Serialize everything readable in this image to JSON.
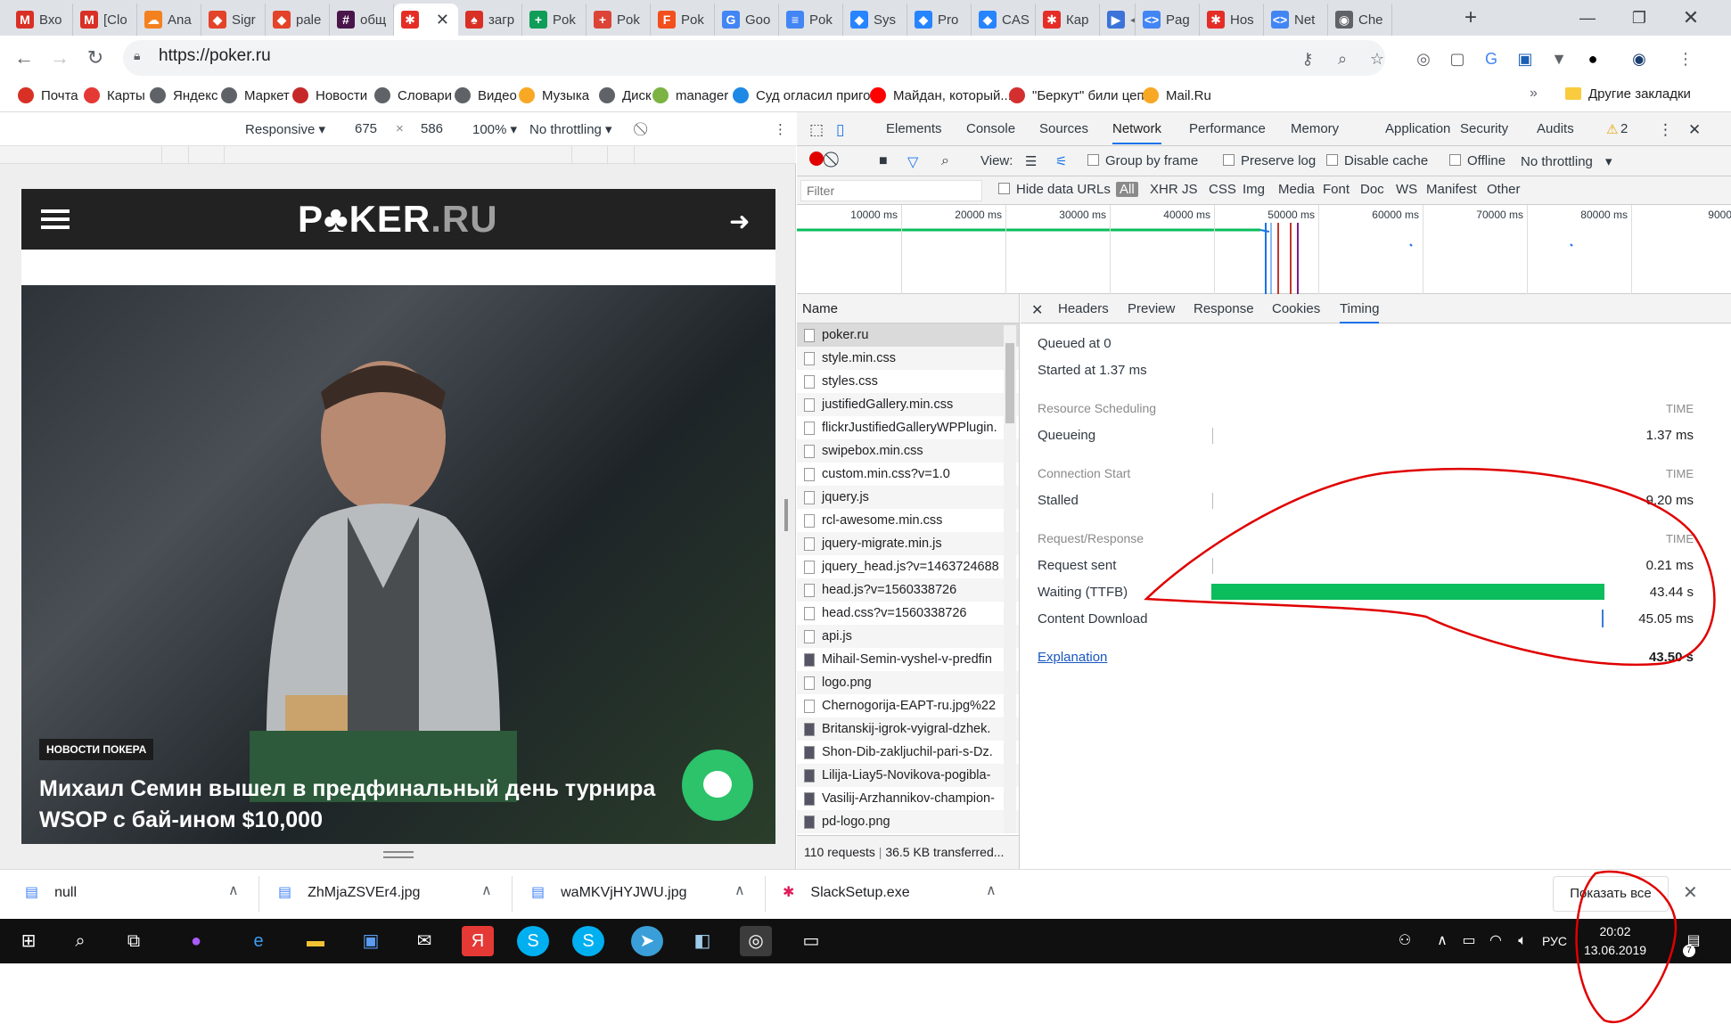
{
  "browser": {
    "tabs": [
      {
        "label": "Вхо",
        "icon": "gmail-icon",
        "color": "#d93025",
        "glyph": "M"
      },
      {
        "label": "[Clo",
        "icon": "gmail-icon",
        "color": "#d93025",
        "glyph": "M"
      },
      {
        "label": "Ana",
        "icon": "cloud-icon",
        "color": "#f48120",
        "glyph": "☁"
      },
      {
        "label": "Sigr",
        "icon": "gitlab-icon",
        "color": "#e24329",
        "glyph": "◆"
      },
      {
        "label": "pale",
        "icon": "gitlab-icon",
        "color": "#e24329",
        "glyph": "◆"
      },
      {
        "label": "общ",
        "icon": "slack-icon",
        "color": "#4a154b",
        "glyph": "#"
      },
      {
        "label": "",
        "icon": "poker-icon",
        "color": "#e52d27",
        "glyph": "✱"
      },
      {
        "label": "загр",
        "icon": "spade-icon",
        "color": "#d93025",
        "glyph": "♠"
      },
      {
        "label": "Pok",
        "icon": "sheets-icon",
        "color": "#0f9d58",
        "glyph": "+"
      },
      {
        "label": "Pok",
        "icon": "plus-square-icon",
        "color": "#db4437",
        "glyph": "+"
      },
      {
        "label": "Pok",
        "icon": "figma-icon",
        "color": "#f24e1e",
        "glyph": "F"
      },
      {
        "label": "Goo",
        "icon": "translate-icon",
        "color": "#4285f4",
        "glyph": "G"
      },
      {
        "label": "Pok",
        "icon": "docs-icon",
        "color": "#4285f4",
        "glyph": "≡"
      },
      {
        "label": "Sys",
        "icon": "jira-icon",
        "color": "#2684ff",
        "glyph": "◆"
      },
      {
        "label": "Pro",
        "icon": "jira-icon",
        "color": "#2684ff",
        "glyph": "◆"
      },
      {
        "label": "CAS",
        "icon": "jira-icon",
        "color": "#2684ff",
        "glyph": "◆"
      },
      {
        "label": "Кар",
        "icon": "poker-icon",
        "color": "#e52d27",
        "glyph": "✱"
      },
      {
        "label": "",
        "icon": "media-icon",
        "color": "#3b73d9",
        "glyph": "▶"
      },
      {
        "label": "Pag",
        "icon": "code-icon",
        "color": "#4285f4",
        "glyph": "<>"
      },
      {
        "label": "Hos",
        "icon": "poker-icon",
        "color": "#e52d27",
        "glyph": "✱"
      },
      {
        "label": "Net",
        "icon": "code-icon",
        "color": "#4285f4",
        "glyph": "<>"
      },
      {
        "label": "Che",
        "icon": "globe-icon",
        "color": "#5f6368",
        "glyph": "◉"
      }
    ],
    "url": "https://poker.ru",
    "bookmarks": [
      {
        "label": "Почта",
        "icon": "mail-icon",
        "color": "#d93025"
      },
      {
        "label": "Карты",
        "icon": "map-pin-icon",
        "color": "#e53935"
      },
      {
        "label": "Яндекс",
        "icon": "globe-icon",
        "color": "#5f6368"
      },
      {
        "label": "Маркет",
        "icon": "globe-icon",
        "color": "#5f6368"
      },
      {
        "label": "Новости",
        "icon": "news-icon",
        "color": "#c62828"
      },
      {
        "label": "Словари",
        "icon": "globe-icon",
        "color": "#5f6368"
      },
      {
        "label": "Видео",
        "icon": "globe-icon",
        "color": "#5f6368"
      },
      {
        "label": "Музыка",
        "icon": "music-icon",
        "color": "#f9a825"
      },
      {
        "label": "Диск",
        "icon": "globe-icon",
        "color": "#5f6368"
      },
      {
        "label": "manager",
        "icon": "fl-icon",
        "color": "#7cb342"
      },
      {
        "label": "Суд огласил приго...",
        "icon": "y-icon",
        "color": "#1e88e5"
      },
      {
        "label": "Майдан, который...",
        "icon": "youtube-icon",
        "color": "#ff0000"
      },
      {
        "label": "\"Беркут\" били цеп...",
        "icon": "24-icon",
        "color": "#d32f2f"
      },
      {
        "label": "Mail.Ru",
        "icon": "mailru-icon",
        "color": "#f9a825"
      }
    ],
    "more_bookmarks": "»",
    "other_bookmarks": "Другие закладки"
  },
  "device_toolbar": {
    "mode": "Responsive",
    "width": "675",
    "height": "586",
    "zoom": "100%",
    "throttling": "No throttling"
  },
  "site": {
    "logo_main": "P♣KER",
    "logo_suffix": ".RU",
    "badge": "НОВОСТИ ПОКЕРА",
    "headline": "Михаил Семин вышел в предфинальный день турнира WSOP с бай-ином $10,000"
  },
  "devtools": {
    "tabs": [
      "Elements",
      "Console",
      "Sources",
      "Network",
      "Performance",
      "Memory",
      "Application",
      "Security",
      "Audits"
    ],
    "selected_tab": "Network",
    "warnings": "2",
    "view_label": "View:",
    "group_by_frame": "Group by frame",
    "preserve_log": "Preserve log",
    "disable_cache": "Disable cache",
    "offline": "Offline",
    "throttling": "No throttling",
    "filter_placeholder": "Filter",
    "hide_data_urls": "Hide data URLs",
    "filter_types": [
      "All",
      "XHR",
      "JS",
      "CSS",
      "Img",
      "Media",
      "Font",
      "Doc",
      "WS",
      "Manifest",
      "Other"
    ],
    "overview_ticks": [
      "10000 ms",
      "20000 ms",
      "30000 ms",
      "40000 ms",
      "50000 ms",
      "60000 ms",
      "70000 ms",
      "80000 ms",
      "9000"
    ],
    "name_header": "Name",
    "requests": [
      {
        "name": "poker.ru",
        "type": "doc"
      },
      {
        "name": "style.min.css",
        "type": "doc"
      },
      {
        "name": "styles.css",
        "type": "doc"
      },
      {
        "name": "justifiedGallery.min.css",
        "type": "doc"
      },
      {
        "name": "flickrJustifiedGalleryWPPlugin.",
        "type": "doc"
      },
      {
        "name": "swipebox.min.css",
        "type": "doc"
      },
      {
        "name": "custom.min.css?v=1.0",
        "type": "doc"
      },
      {
        "name": "jquery.js",
        "type": "doc"
      },
      {
        "name": "rcl-awesome.min.css",
        "type": "doc"
      },
      {
        "name": "jquery-migrate.min.js",
        "type": "doc"
      },
      {
        "name": "jquery_head.js?v=1463724688",
        "type": "doc"
      },
      {
        "name": "head.js?v=1560338726",
        "type": "doc"
      },
      {
        "name": "head.css?v=1560338726",
        "type": "doc"
      },
      {
        "name": "api.js",
        "type": "doc"
      },
      {
        "name": "Mihail-Semin-vyshel-v-predfin",
        "type": "img"
      },
      {
        "name": "logo.png",
        "type": "doc"
      },
      {
        "name": "Chernogorija-EAPT-ru.jpg%22",
        "type": "doc"
      },
      {
        "name": "Britanskij-igrok-vyigral-dzhek.",
        "type": "img"
      },
      {
        "name": "Shon-Dib-zakljuchil-pari-s-Dz.",
        "type": "img"
      },
      {
        "name": "Lilija-Liay5-Novikova-pogibla-",
        "type": "img"
      },
      {
        "name": "Vasilij-Arzhannikov-champion-",
        "type": "img"
      },
      {
        "name": "pd-logo.png",
        "type": "img"
      }
    ],
    "summary_requests": "110 requests",
    "summary_transferred": "36.5 KB transferred...",
    "detail_tabs": [
      "Headers",
      "Preview",
      "Response",
      "Cookies",
      "Timing"
    ],
    "selected_detail_tab": "Timing",
    "timing": {
      "queued_at": "Queued at 0",
      "started_at": "Started at 1.37 ms",
      "time_label": "TIME",
      "sections": [
        {
          "title": "Resource Scheduling",
          "rows": [
            {
              "label": "Queueing",
              "value": "1.37 ms"
            }
          ]
        },
        {
          "title": "Connection Start",
          "rows": [
            {
              "label": "Stalled",
              "value": "9.20 ms"
            }
          ]
        },
        {
          "title": "Request/Response",
          "rows": [
            {
              "label": "Request sent",
              "value": "0.21 ms"
            },
            {
              "label": "Waiting (TTFB)",
              "value": "43.44 s"
            },
            {
              "label": "Content Download",
              "value": "45.05 ms"
            }
          ]
        }
      ],
      "explanation": "Explanation",
      "total": "43.50 s"
    }
  },
  "downloads": [
    {
      "name": "null",
      "icon": "file-icon"
    },
    {
      "name": "ZhMjaZSVEr4.jpg",
      "icon": "image-file-icon"
    },
    {
      "name": "waMKVjHYJWU.jpg",
      "icon": "image-file-icon"
    },
    {
      "name": "SlackSetup.exe",
      "icon": "slack-icon"
    }
  ],
  "show_all": "Показать все",
  "taskbar": {
    "language": "РУС",
    "time": "20:02",
    "date": "13.06.2019",
    "notifications": "7"
  },
  "colors": {
    "ttfb": "#0bbd5c",
    "accent": "#1a73e8",
    "chat": "#2cc36b",
    "annotation": "#e00000"
  }
}
